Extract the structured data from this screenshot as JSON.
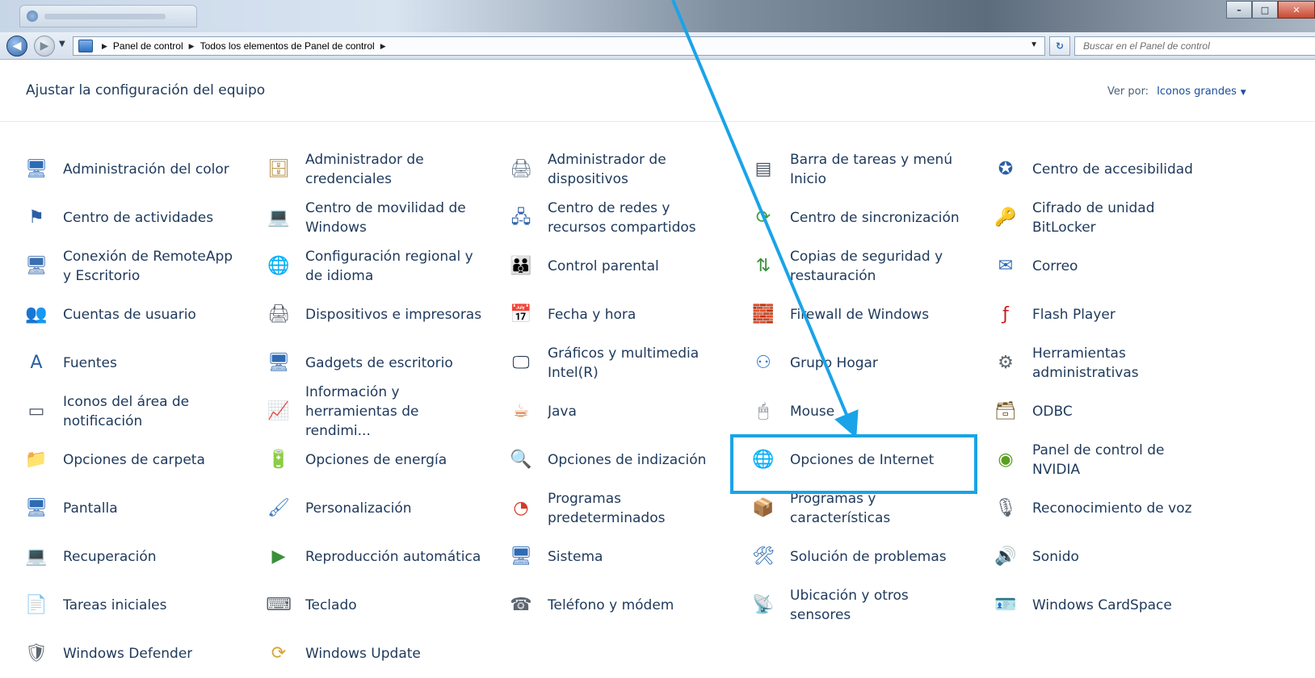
{
  "breadcrumb": {
    "items": [
      "Panel de control",
      "Todos los elementos de Panel de control"
    ]
  },
  "search": {
    "placeholder": "Buscar en el Panel de control"
  },
  "header": {
    "title": "Ajustar la configuración del equipo",
    "view_by_label": "Ver por:",
    "view_by_value": "Iconos grandes"
  },
  "items": [
    {
      "label": "Administración del color",
      "icon": "color-management-icon",
      "glyph": "🖥",
      "color": "#2b6cb8"
    },
    {
      "label": "Administrador de credenciales",
      "icon": "credential-manager-icon",
      "glyph": "🗄",
      "color": "#b08a3c"
    },
    {
      "label": "Administrador de dispositivos",
      "icon": "device-manager-icon",
      "glyph": "🖨",
      "color": "#6b7b8c"
    },
    {
      "label": "Barra de tareas y menú Inicio",
      "icon": "taskbar-icon",
      "glyph": "▤",
      "color": "#4a5563"
    },
    {
      "label": "Centro de accesibilidad",
      "icon": "accessibility-icon",
      "glyph": "✪",
      "color": "#2a5fa5"
    },
    {
      "label": "Centro de actividades",
      "icon": "action-center-flag-icon",
      "glyph": "⚑",
      "color": "#2a5fa5"
    },
    {
      "label": "Centro de movilidad de Windows",
      "icon": "mobility-center-icon",
      "glyph": "💻",
      "color": "#3c7ac4"
    },
    {
      "label": "Centro de redes y recursos compartidos",
      "icon": "network-center-icon",
      "glyph": "🖧",
      "color": "#2c62a8"
    },
    {
      "label": "Centro de sincronización",
      "icon": "sync-center-icon",
      "glyph": "⟳",
      "color": "#3aa33a"
    },
    {
      "label": "Cifrado de unidad BitLocker",
      "icon": "bitlocker-key-icon",
      "glyph": "🔑",
      "color": "#c9a23b"
    },
    {
      "label": "Conexión de RemoteApp y Escritorio",
      "icon": "remoteapp-icon",
      "glyph": "🖥",
      "color": "#3c6fb0"
    },
    {
      "label": "Configuración regional y de idioma",
      "icon": "region-language-icon",
      "glyph": "🌐",
      "color": "#2f7bc6"
    },
    {
      "label": "Control parental",
      "icon": "parental-control-icon",
      "glyph": "👪",
      "color": "#3f7b3a"
    },
    {
      "label": "Copias de seguridad y restauración",
      "icon": "backup-restore-icon",
      "glyph": "⇅",
      "color": "#3a8f3a"
    },
    {
      "label": "Correo",
      "icon": "mail-icon",
      "glyph": "✉",
      "color": "#2d6bb5"
    },
    {
      "label": "Cuentas de usuario",
      "icon": "user-accounts-icon",
      "glyph": "👥",
      "color": "#3c8c3c"
    },
    {
      "label": "Dispositivos e impresoras",
      "icon": "devices-printers-icon",
      "glyph": "🖨",
      "color": "#5c6670"
    },
    {
      "label": "Fecha y hora",
      "icon": "date-time-icon",
      "glyph": "📅",
      "color": "#2d6bb5"
    },
    {
      "label": "Firewall de Windows",
      "icon": "firewall-icon",
      "glyph": "🧱",
      "color": "#a0442a"
    },
    {
      "label": "Flash Player",
      "icon": "flash-player-icon",
      "glyph": "ƒ",
      "color": "#cc1b1b"
    },
    {
      "label": "Fuentes",
      "icon": "fonts-icon",
      "glyph": "A",
      "color": "#2a5fa5"
    },
    {
      "label": "Gadgets de escritorio",
      "icon": "desktop-gadgets-icon",
      "glyph": "🖥",
      "color": "#2d6bb5"
    },
    {
      "label": "Gráficos y multimedia Intel(R)",
      "icon": "intel-graphics-icon",
      "glyph": "🖵",
      "color": "#1f2f45"
    },
    {
      "label": "Grupo Hogar",
      "icon": "homegroup-icon",
      "glyph": "⚇",
      "color": "#2f7bc6"
    },
    {
      "label": "Herramientas administrativas",
      "icon": "admin-tools-icon",
      "glyph": "⚙",
      "color": "#5c6670"
    },
    {
      "label": "Iconos del área de notificación",
      "icon": "notification-area-icon",
      "glyph": "▭",
      "color": "#4a5563"
    },
    {
      "label": "Información y herramientas de rendimi...",
      "icon": "performance-icon",
      "glyph": "📈",
      "color": "#2f8f3a"
    },
    {
      "label": "Java",
      "icon": "java-icon",
      "glyph": "☕",
      "color": "#d2661f"
    },
    {
      "label": "Mouse",
      "icon": "mouse-icon",
      "glyph": "🖱",
      "color": "#5c6670"
    },
    {
      "label": "ODBC",
      "icon": "odbc-icon",
      "glyph": "🗃",
      "color": "#7a5c2a"
    },
    {
      "label": "Opciones de carpeta",
      "icon": "folder-options-icon",
      "glyph": "📁",
      "color": "#d6a531"
    },
    {
      "label": "Opciones de energía",
      "icon": "power-options-icon",
      "glyph": "🔋",
      "color": "#3a8f3a"
    },
    {
      "label": "Opciones de indización",
      "icon": "indexing-options-icon",
      "glyph": "🔍",
      "color": "#5c6670"
    },
    {
      "label": "Opciones de Internet",
      "icon": "internet-options-icon",
      "glyph": "🌐",
      "color": "#2f7bc6"
    },
    {
      "label": "Panel de control de NVIDIA",
      "icon": "nvidia-icon",
      "glyph": "◉",
      "color": "#5a9f1f"
    },
    {
      "label": "Pantalla",
      "icon": "display-icon",
      "glyph": "🖥",
      "color": "#2d6bb5"
    },
    {
      "label": "Personalización",
      "icon": "personalization-icon",
      "glyph": "🖌",
      "color": "#3c7ac4"
    },
    {
      "label": "Programas predeterminados",
      "icon": "default-programs-icon",
      "glyph": "◔",
      "color": "#d13b2a"
    },
    {
      "label": "Programas y características",
      "icon": "programs-features-icon",
      "glyph": "📦",
      "color": "#5c6670"
    },
    {
      "label": "Reconocimiento de voz",
      "icon": "speech-recognition-icon",
      "glyph": "🎙",
      "color": "#5c6670"
    },
    {
      "label": "Recuperación",
      "icon": "recovery-icon",
      "glyph": "💻",
      "color": "#2d6bb5"
    },
    {
      "label": "Reproducción automática",
      "icon": "autoplay-icon",
      "glyph": "▶",
      "color": "#3a8f3a"
    },
    {
      "label": "Sistema",
      "icon": "system-icon",
      "glyph": "🖥",
      "color": "#2d6bb5"
    },
    {
      "label": "Solución de problemas",
      "icon": "troubleshooting-icon",
      "glyph": "🛠",
      "color": "#2d6bb5"
    },
    {
      "label": "Sonido",
      "icon": "sound-icon",
      "glyph": "🔊",
      "color": "#5c6670"
    },
    {
      "label": "Tareas iniciales",
      "icon": "getting-started-icon",
      "glyph": "📄",
      "color": "#2d6bb5"
    },
    {
      "label": "Teclado",
      "icon": "keyboard-icon",
      "glyph": "⌨",
      "color": "#5c6670"
    },
    {
      "label": "Teléfono y módem",
      "icon": "phone-modem-icon",
      "glyph": "☎",
      "color": "#5c6670"
    },
    {
      "label": "Ubicación y otros sensores",
      "icon": "location-sensors-icon",
      "glyph": "📡",
      "color": "#5c6670"
    },
    {
      "label": "Windows CardSpace",
      "icon": "cardspace-icon",
      "glyph": "🪪",
      "color": "#3c7ac4"
    },
    {
      "label": "Windows Defender",
      "icon": "windows-defender-icon",
      "glyph": "🛡",
      "color": "#5c6670"
    },
    {
      "label": "Windows Update",
      "icon": "windows-update-icon",
      "glyph": "⟳",
      "color": "#d6a531"
    }
  ],
  "annotation": {
    "highlight_color": "#1aa3e8"
  }
}
